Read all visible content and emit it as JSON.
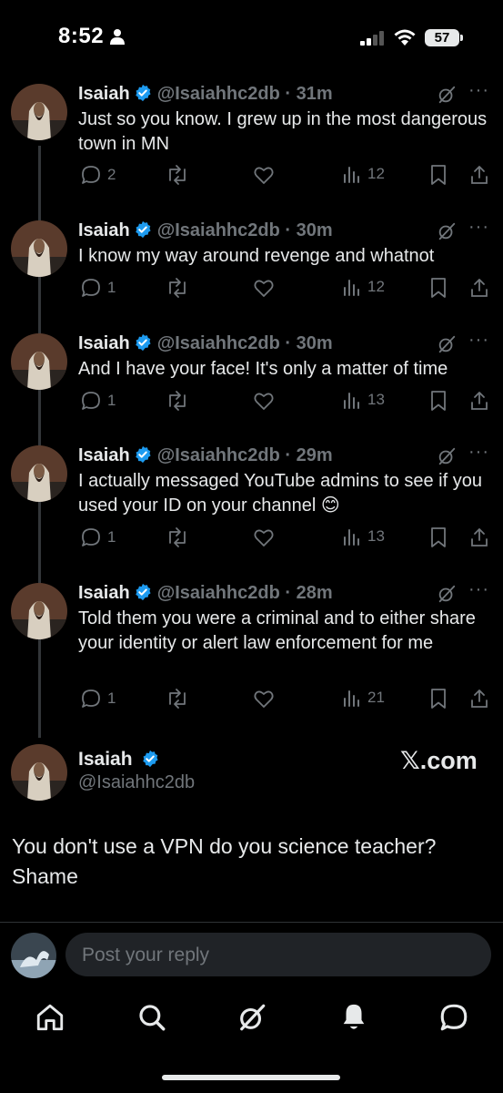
{
  "status_bar": {
    "time": "8:52",
    "battery": "57"
  },
  "tweets": [
    {
      "name": "Isaiah",
      "handle": "@Isaiahhc2db",
      "time": "31m",
      "text": "Just so you know. I grew up in the most dangerous town in MN",
      "replies": "2",
      "views": "12"
    },
    {
      "name": "Isaiah",
      "handle": "@Isaiahhc2db",
      "time": "30m",
      "text": "I know my way around revenge and whatnot",
      "replies": "1",
      "views": "12"
    },
    {
      "name": "Isaiah",
      "handle": "@Isaiahhc2db",
      "time": "30m",
      "text": "And I have your face! It's only a matter of time",
      "replies": "1",
      "views": "13"
    },
    {
      "name": "Isaiah",
      "handle": "@Isaiahhc2db",
      "time": "29m",
      "text": "I actually messaged YouTube admins to see if you used your ID on your channel 😊",
      "replies": "1",
      "views": "13"
    },
    {
      "name": "Isaiah",
      "handle": "@Isaiahhc2db",
      "time": "28m",
      "text": "Told them you were a criminal and to either share your identity or alert law enforcement for me",
      "replies": "1",
      "views": "21"
    }
  ],
  "quoted": {
    "name": "Isaiah",
    "handle": "@Isaiahhc2db",
    "watermark": "𝕏.com",
    "text": "You don't use a VPN do you science teacher? Shame"
  },
  "reply": {
    "placeholder": "Post your reply"
  },
  "colors": {
    "verified": "#1d9bf0",
    "muted": "#71767b",
    "text": "#e7e9ea",
    "background": "#000000"
  },
  "icons": [
    "home-icon",
    "search-icon",
    "grok-icon",
    "notifications-icon",
    "messages-icon"
  ]
}
